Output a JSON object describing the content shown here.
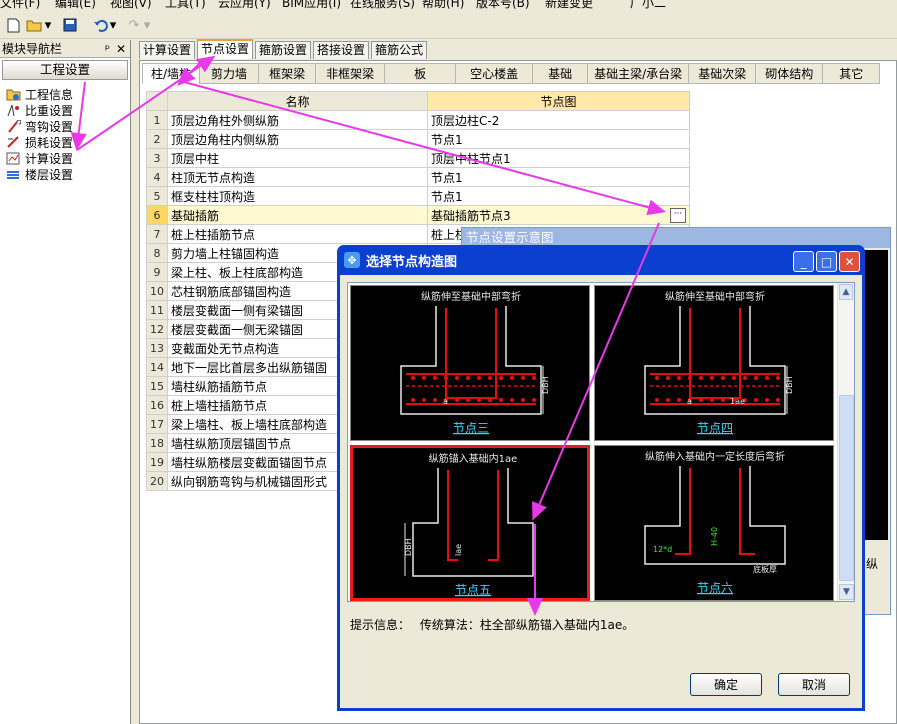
{
  "menubar": {
    "items": [
      "文件(F)",
      "编辑(E)",
      "视图(V)",
      "工具(T)",
      "云应用(Y)",
      "BIM应用(I)",
      "在线服务(S)",
      "帮助(H)",
      "版本号(B)",
      "新建变更",
      "广小二"
    ]
  },
  "toolbar": {
    "icons": [
      "new-file-icon",
      "open-folder-icon",
      "save-icon",
      "undo-icon",
      "redo-icon"
    ]
  },
  "nav": {
    "title": "模块导航栏",
    "pin_glyph": "ᵖ",
    "close_glyph": "✕",
    "group": "工程设置",
    "items": [
      {
        "label": "工程信息",
        "icon": "info-icon"
      },
      {
        "label": "比重设置",
        "icon": "weight-icon"
      },
      {
        "label": "弯钩设置",
        "icon": "hook-icon"
      },
      {
        "label": "损耗设置",
        "icon": "loss-icon"
      },
      {
        "label": "计算设置",
        "icon": "calc-icon"
      },
      {
        "label": "楼层设置",
        "icon": "floor-icon"
      }
    ]
  },
  "tabs": [
    "计算设置",
    "节点设置",
    "箍筋设置",
    "搭接设置",
    "箍筋公式"
  ],
  "active_tab": "节点设置",
  "subtabs": [
    "柱/墙柱",
    "剪力墙",
    "框架梁",
    "非框架梁",
    "板",
    "空心楼盖",
    "基础",
    "基础主梁/承台梁",
    "基础次梁",
    "砌体结构",
    "其它"
  ],
  "grid": {
    "headers": [
      "名称",
      "节点图"
    ],
    "rows": [
      {
        "no": "1",
        "name": "顶层边角柱外侧纵筋",
        "node": "顶层边柱C-2"
      },
      {
        "no": "2",
        "name": "顶层边角柱内侧纵筋",
        "node": "节点1"
      },
      {
        "no": "3",
        "name": "顶层中柱",
        "node": "顶层中柱节点1"
      },
      {
        "no": "4",
        "name": "柱顶无节点构造",
        "node": "节点1"
      },
      {
        "no": "5",
        "name": "框支柱柱顶构造",
        "node": "节点1"
      },
      {
        "no": "6",
        "name": "基础插筋",
        "node": "基础插筋节点3"
      },
      {
        "no": "7",
        "name": "桩上柱插筋节点",
        "node": "桩上柱"
      },
      {
        "no": "8",
        "name": "剪力墙上柱锚固构造",
        "node": ""
      },
      {
        "no": "9",
        "name": "梁上柱、板上柱底部构造",
        "node": ""
      },
      {
        "no": "10",
        "name": "芯柱钢筋底部锚固构造",
        "node": ""
      },
      {
        "no": "11",
        "name": "楼层变截面一侧有梁锚固",
        "node": ""
      },
      {
        "no": "12",
        "name": "楼层变截面一侧无梁锚固",
        "node": ""
      },
      {
        "no": "13",
        "name": "变截面处无节点构造",
        "node": ""
      },
      {
        "no": "14",
        "name": "地下一层比首层多出纵筋锚固",
        "node": ""
      },
      {
        "no": "15",
        "name": "墙柱纵筋插筋节点",
        "node": ""
      },
      {
        "no": "16",
        "name": "桩上墙柱插筋节点",
        "node": ""
      },
      {
        "no": "17",
        "name": "梁上墙柱、板上墙柱底部构造",
        "node": ""
      },
      {
        "no": "18",
        "name": "墙柱纵筋顶层锚固节点",
        "node": ""
      },
      {
        "no": "19",
        "name": "墙柱纵筋楼层变截面锚固节点",
        "node": ""
      },
      {
        "no": "20",
        "name": "纵向钢筋弯钩与机械锚固形式",
        "node": ""
      }
    ],
    "selected_row": 6,
    "ellipsis": "···"
  },
  "bg_window": {
    "title": "节点设置示意图",
    "edge_text": "纵"
  },
  "dialog": {
    "title": "选择节点构造图",
    "title_icon": "✥",
    "buttons": {
      "minimize": "_",
      "maximize": "□",
      "close": "✕",
      "ok": "确定",
      "cancel": "取消"
    },
    "cells": [
      {
        "heading": "纵筋伸至基础中部弯折",
        "caption": "节点三",
        "dim_a": "a",
        "dim_h": "DBH",
        "selected": false
      },
      {
        "heading": "纵筋伸至基础中部弯折",
        "caption": "节点四",
        "dim_a": "a",
        "dim_h": "DBH",
        "dim_lae": "1ae",
        "selected": false
      },
      {
        "heading": "纵筋锚入基础内1ae",
        "caption": "节点五",
        "dim_h": "DBH",
        "dim_lae": "lae",
        "selected": true
      },
      {
        "heading": "纵筋伸入基础内一定长度后弯折",
        "caption": "节点六",
        "dim_d": "12*d",
        "dim_h": "H-40",
        "dim_b": "底板厚",
        "selected": false
      }
    ],
    "info_label": "提示信息：",
    "info_text": "传统算法：柱全部纵筋锚入基础内1ae。"
  },
  "colors": {
    "annotation_arrow": "#e839e8",
    "selection": "#e81c1c",
    "caption": "#3ad6ff",
    "rebar": "#e01010"
  }
}
